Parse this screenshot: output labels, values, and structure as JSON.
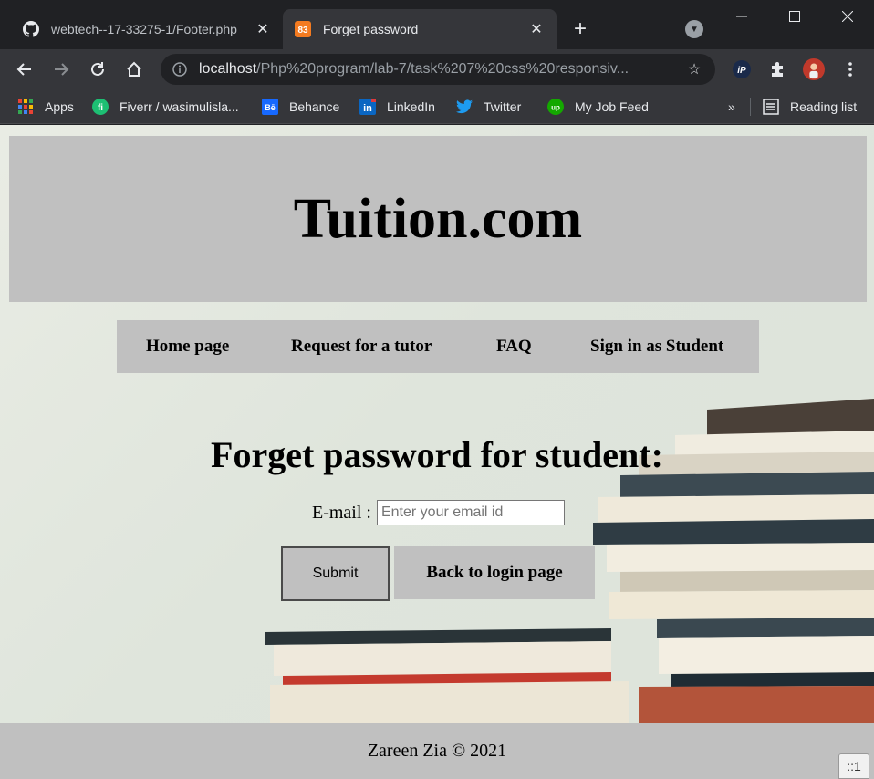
{
  "browser": {
    "tabs": [
      {
        "title": "webtech--17-33275-1/Footer.php",
        "icon": "github-icon"
      },
      {
        "title": "Forget password",
        "icon": "xampp-icon"
      }
    ],
    "url_host": "localhost",
    "url_path": "/Php%20program/lab-7/task%207%20css%20responsiv...",
    "bookmarks": [
      {
        "label": "Apps",
        "icon": "apps-grid-icon"
      },
      {
        "label": "Fiverr / wasimulisla...",
        "icon": "fiverr-icon"
      },
      {
        "label": "Behance",
        "icon": "behance-icon"
      },
      {
        "label": "LinkedIn",
        "icon": "linkedin-icon"
      },
      {
        "label": "Twitter",
        "icon": "twitter-icon"
      },
      {
        "label": "My Job Feed",
        "icon": "upwork-icon"
      }
    ],
    "reading_list": "Reading list",
    "overflow": "»"
  },
  "site": {
    "title": "Tuition.com",
    "nav": [
      "Home page",
      "Request for a tutor",
      "FAQ",
      "Sign in as Student"
    ],
    "form": {
      "heading": "Forget password for student:",
      "email_label": "E-mail :",
      "email_placeholder": "Enter your email id",
      "submit_label": "Submit",
      "back_label": "Back to login page"
    },
    "footer": "Zareen Zia © 2021",
    "badge": "::1"
  },
  "colors": {
    "panel": "#c0c0c0",
    "chrome_dark": "#202124",
    "chrome_toolbar": "#35363a"
  }
}
